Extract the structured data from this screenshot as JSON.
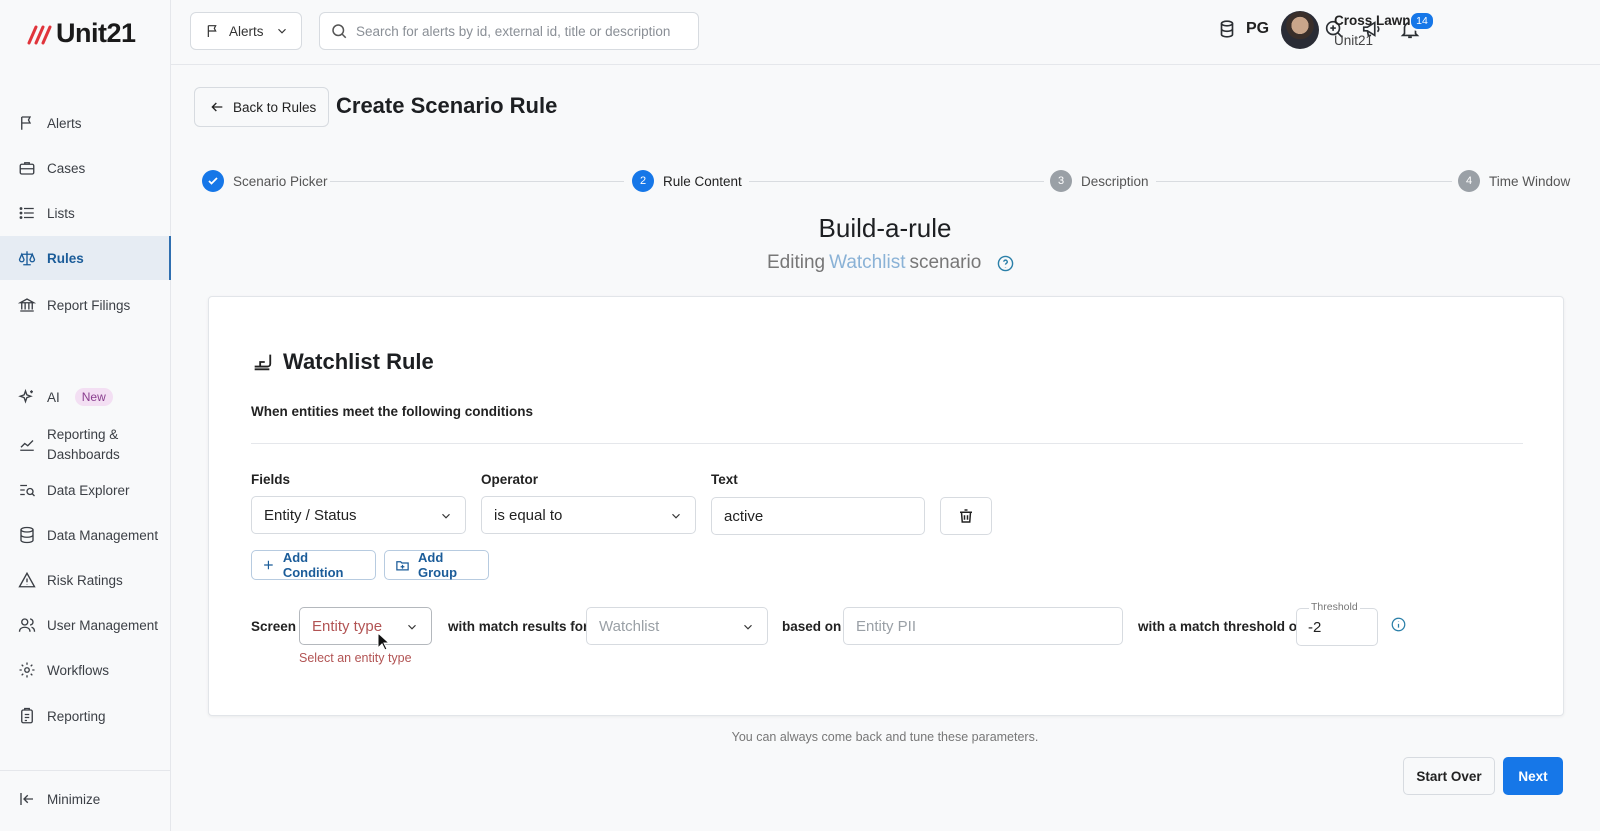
{
  "brand": {
    "name": "Unit21"
  },
  "sidebar": {
    "items": [
      {
        "label": "Alerts"
      },
      {
        "label": "Cases"
      },
      {
        "label": "Lists"
      },
      {
        "label": "Rules"
      },
      {
        "label": "Report Filings"
      },
      {
        "label": "AI",
        "badge": "New"
      },
      {
        "label": "Reporting &",
        "label2": "Dashboards"
      },
      {
        "label": "Data Explorer"
      },
      {
        "label": "Data Management"
      },
      {
        "label": "Risk Ratings"
      },
      {
        "label": "User Management"
      },
      {
        "label": "Workflows"
      },
      {
        "label": "Reporting"
      }
    ],
    "minimize": "Minimize"
  },
  "topbar": {
    "alerts_dropdown": "Alerts",
    "search_placeholder": "Search for alerts by id, external id, title or description",
    "db_label": "PG",
    "notification_count": "14",
    "user_name": "Cross Lawn",
    "user_org": "Unit21"
  },
  "header": {
    "back_label": "Back to Rules",
    "title": "Create Scenario Rule"
  },
  "stepper": {
    "steps": [
      {
        "number": "",
        "label": "Scenario Picker",
        "state": "done"
      },
      {
        "number": "2",
        "label": "Rule Content",
        "state": "current"
      },
      {
        "number": "3",
        "label": "Description",
        "state": "todo"
      },
      {
        "number": "4",
        "label": "Time Window",
        "state": "todo"
      }
    ]
  },
  "builder": {
    "title": "Build-a-rule",
    "subtitle_prefix": "Editing",
    "subtitle_highlight": "Watchlist",
    "subtitle_suffix": "scenario"
  },
  "card": {
    "title": "Watchlist Rule",
    "conditions_label": "When entities meet the following conditions",
    "columns": {
      "fields": "Fields",
      "operator": "Operator",
      "text": "Text"
    },
    "condition": {
      "field": "Entity / Status",
      "operator": "is equal to",
      "text": "active"
    },
    "add_condition": "Add Condition",
    "add_group": "Add Group",
    "screen": {
      "screen_label": "Screen",
      "entity_type_placeholder": "Entity type",
      "entity_type_error": "Select an entity type",
      "match_label": "with match results for",
      "watchlist_placeholder": "Watchlist",
      "based_on_label": "based on",
      "pii_placeholder": "Entity PII",
      "threshold_label": "with a match threshold of",
      "threshold_legend": "Threshold",
      "threshold_value": "-2"
    }
  },
  "footer": {
    "note": "You can always come back and tune these parameters.",
    "start_over": "Start Over",
    "next": "Next"
  },
  "colors": {
    "accent": "#1677e8",
    "active_nav": "#1b5c99",
    "error": "#b25454"
  }
}
